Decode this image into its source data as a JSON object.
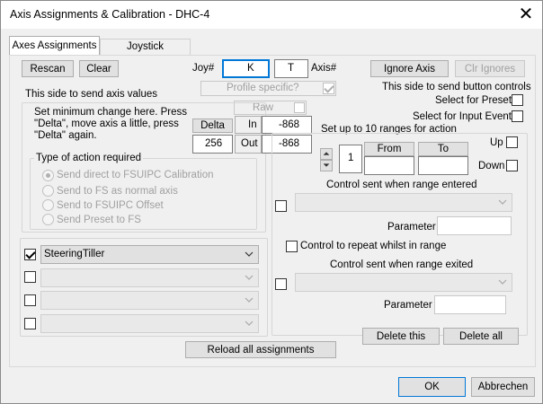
{
  "window": {
    "title": "Axis Assignments & Calibration - DHC-4"
  },
  "tabs": [
    {
      "label": "Axes Assignments",
      "active": true
    },
    {
      "label": "Joystick Calibration",
      "active": false
    }
  ],
  "top": {
    "rescan": "Rescan",
    "clear": "Clear",
    "joy_label": "Joy#",
    "joy_value": "K",
    "axis_value": "T",
    "axis_label": "Axis#",
    "ignore_axis": "Ignore Axis",
    "clr_ignores": "Clr Ignores",
    "profile_specific": "Profile specific?",
    "raw": "Raw"
  },
  "left": {
    "side_label": "This side to send axis values",
    "min_change_text": "Set minimum change here.  Press \"Delta\", move axis a little,  press \"Delta\" again.",
    "delta_button": "Delta",
    "delta_value": "256",
    "in_label": "In",
    "in_value": "-868",
    "out_label": "Out",
    "out_value": "-868",
    "action_group": "Type of action required",
    "actions": [
      {
        "label": "Send direct to FSUIPC Calibration",
        "selected": true
      },
      {
        "label": "Send to FS as normal axis",
        "selected": false
      },
      {
        "label": "Send to FSUIPC Offset",
        "selected": false
      },
      {
        "label": "Send Preset to FS",
        "selected": false
      }
    ],
    "assignments": [
      {
        "checked": true,
        "value": "SteeringTiller"
      },
      {
        "checked": false,
        "value": ""
      },
      {
        "checked": false,
        "value": ""
      },
      {
        "checked": false,
        "value": ""
      }
    ]
  },
  "right": {
    "side_label": "This side to send button controls",
    "select_preset": "Select for Preset",
    "select_input_event": "Select for Input Event",
    "ranges_label": "Set up to 10 ranges for action",
    "range_number": "1",
    "from_button": "From",
    "to_button": "To",
    "up_label": "Up",
    "down_label": "Down",
    "control_entered": "Control sent when range entered",
    "parameter_label": "Parameter",
    "repeat_label": "Control to repeat whilst in range",
    "control_exited": "Control sent when range exited",
    "parameter2_label": "Parameter",
    "delete_this": "Delete this",
    "delete_all": "Delete all"
  },
  "bottom": {
    "reload": "Reload all assignments",
    "ok": "OK",
    "cancel": "Abbrechen"
  }
}
